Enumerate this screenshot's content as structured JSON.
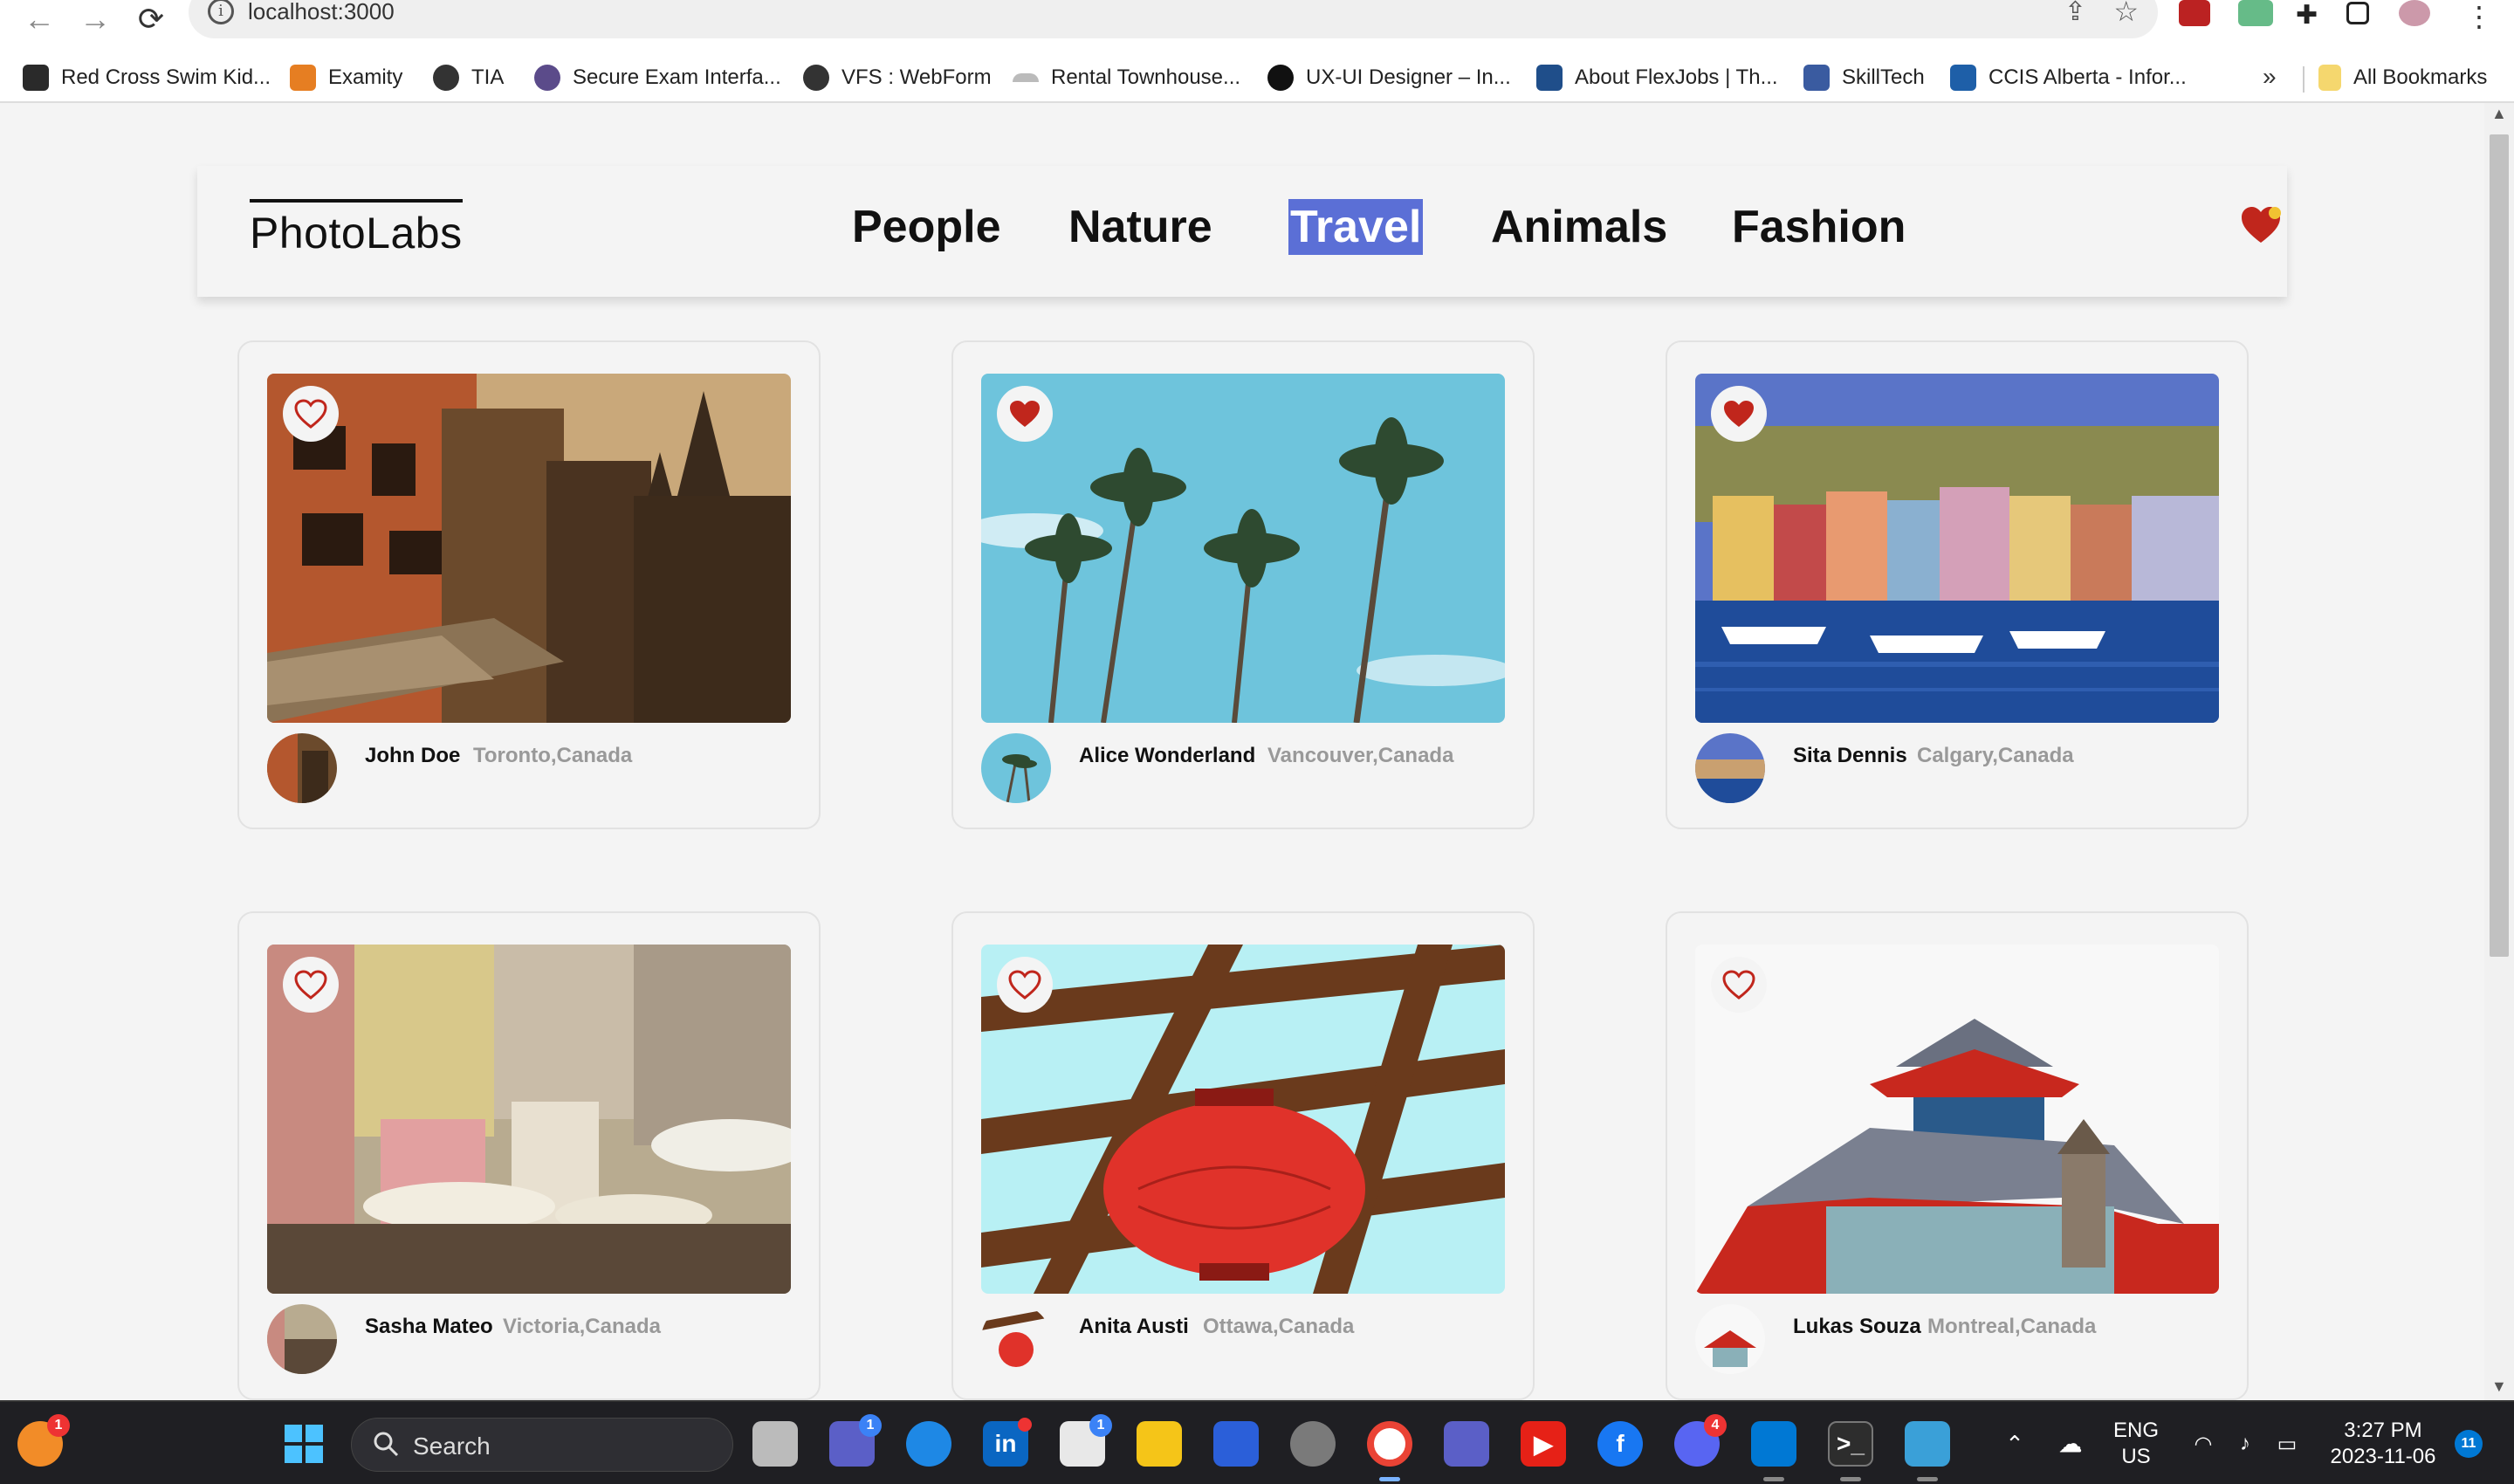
{
  "browser": {
    "url": "localhost:3000",
    "bookmarks": [
      {
        "label": "Red Cross Swim Kid...",
        "color": "#c0392b"
      },
      {
        "label": "Examity",
        "color": "#e67e22"
      },
      {
        "label": "TIA",
        "color": "#333333"
      },
      {
        "label": "Secure Exam Interfa...",
        "color": "#5b4b8a"
      },
      {
        "label": "VFS : WebForm",
        "color": "#333333"
      },
      {
        "label": "Rental Townhouse...",
        "color": "#999999"
      },
      {
        "label": "UX-UI Designer – In...",
        "color": "#111111"
      },
      {
        "label": "About FlexJobs | Th...",
        "color": "#1f4e8a"
      },
      {
        "label": "SkillTech",
        "color": "#3a5ba0"
      },
      {
        "label": "CCIS Alberta - Infor...",
        "color": "#1e5fa8"
      }
    ],
    "more_label": "»",
    "all_bookmarks": "All Bookmarks"
  },
  "app": {
    "logo": "PhotoLabs",
    "topics": [
      {
        "label": "People",
        "active": false
      },
      {
        "label": "Nature",
        "active": false
      },
      {
        "label": "Travel",
        "active": true
      },
      {
        "label": "Animals",
        "active": false
      },
      {
        "label": "Fashion",
        "active": false
      }
    ],
    "favorites_indicator": "heart-with-notification-dot",
    "photos": [
      {
        "name": "John Doe",
        "location": "Toronto,Canada",
        "liked": false,
        "scene": "old-city-buildings"
      },
      {
        "name": "Alice Wonderland",
        "location": "Vancouver,Canada",
        "liked": true,
        "scene": "palm-trees-sky"
      },
      {
        "name": "Sita Dennis",
        "location": "Calgary,Canada",
        "liked": true,
        "scene": "harbour-town"
      },
      {
        "name": "Sasha Mateo",
        "location": "Victoria,Canada",
        "liked": false,
        "scene": "hillside-market"
      },
      {
        "name": "Anita Austi",
        "location": "Ottawa,Canada",
        "liked": false,
        "scene": "red-lantern-pergola"
      },
      {
        "name": "Lukas Souza",
        "location": "Montreal,Canada",
        "liked": false,
        "scene": "pagoda-roof"
      }
    ],
    "colors": {
      "accent": "#5b6fd6",
      "heart": "#c0261c",
      "location": "#999999"
    }
  },
  "taskbar": {
    "search_label": "Search",
    "language": [
      "ENG",
      "US"
    ],
    "time": "3:27 PM",
    "date": "2023-11-06",
    "notification_count": "11",
    "badges": {
      "start_user": "1",
      "chat": "1",
      "linkedin": "",
      "store": "1",
      "discord": "4"
    }
  }
}
